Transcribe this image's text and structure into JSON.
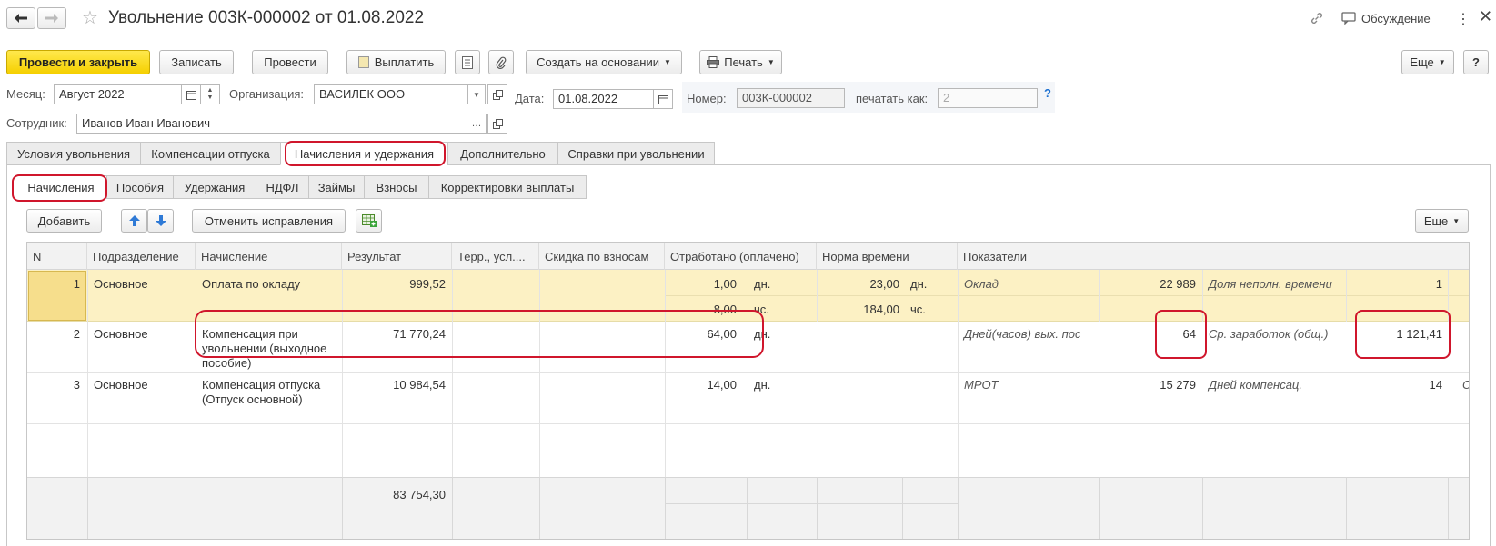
{
  "window": {
    "title": "Увольнение 003К-000002 от 01.08.2022",
    "discussion_label": "Обсуждение"
  },
  "toolbar": {
    "post_close": "Провести и закрыть",
    "save": "Записать",
    "post": "Провести",
    "pay": "Выплатить",
    "create_based": "Создать на основании",
    "print": "Печать",
    "more": "Еще"
  },
  "form": {
    "month_label": "Месяц:",
    "month_value": "Август 2022",
    "org_label": "Организация:",
    "org_value": "ВАСИЛЕК ООО",
    "date_label": "Дата:",
    "date_value": "01.08.2022",
    "number_label": "Номер:",
    "number_value": "003К-000002",
    "print_as_label": "печатать как:",
    "print_as_value": "2",
    "help": "?",
    "employee_label": "Сотрудник:",
    "employee_value": "Иванов Иван Иванович"
  },
  "tabs": [
    "Условия увольнения",
    "Компенсации отпуска",
    "Начисления и удержания",
    "Дополнительно",
    "Справки при увольнении"
  ],
  "subtabs": [
    "Начисления",
    "Пособия",
    "Удержания",
    "НДФЛ",
    "Займы",
    "Взносы",
    "Корректировки выплаты"
  ],
  "table_toolbar": {
    "add": "Добавить",
    "cancel_fix": "Отменить исправления",
    "more": "Еще"
  },
  "columns": [
    "N",
    "Подразделение",
    "Начисление",
    "Результат",
    "Терр., усл....",
    "Скидка по взносам",
    "Отработано (оплачено)",
    "Норма времени",
    "Показатели"
  ],
  "rows": [
    {
      "n": "1",
      "dept": "Основное",
      "accrual": "Оплата по окладу",
      "result": "999,52",
      "worked1": "1,00",
      "worked1_unit": "дн.",
      "norm1": "23,00",
      "norm1_unit": "дн.",
      "worked2": "8,00",
      "worked2_unit": "чс.",
      "norm2": "184,00",
      "norm2_unit": "чс.",
      "ind1_name": "Оклад",
      "ind1_val": "22 989",
      "ind2_name": "Доля неполн. времени",
      "ind2_val": "1"
    },
    {
      "n": "2",
      "dept": "Основное",
      "accrual_l1": "Компенсация при",
      "accrual_l2": "увольнении (выходное",
      "accrual_l3": "пособие)",
      "result": "71 770,24",
      "worked1": "64,00",
      "worked1_unit": "дн.",
      "ind1_name": "Дней(часов) вых. пос",
      "ind1_val": "64",
      "ind2_name": "Ср. заработок (общ.)",
      "ind2_val": "1 121,41"
    },
    {
      "n": "3",
      "dept": "Основное",
      "accrual_l1": "Компенсация отпуска",
      "accrual_l2": "(Отпуск основной)",
      "result": "10 984,54",
      "worked1": "14,00",
      "worked1_unit": "дн.",
      "ind1_name": "МРОТ",
      "ind1_val": "15 279",
      "ind2_name": "Дней компенсац.",
      "ind2_val": "14",
      "ind3_stub": "С"
    }
  ],
  "totals": {
    "result": "83 754,30"
  },
  "colors": {
    "accent_yellow": "#f5d000",
    "selected_row": "#fcf1c4",
    "highlight_red": "#d0162c"
  }
}
